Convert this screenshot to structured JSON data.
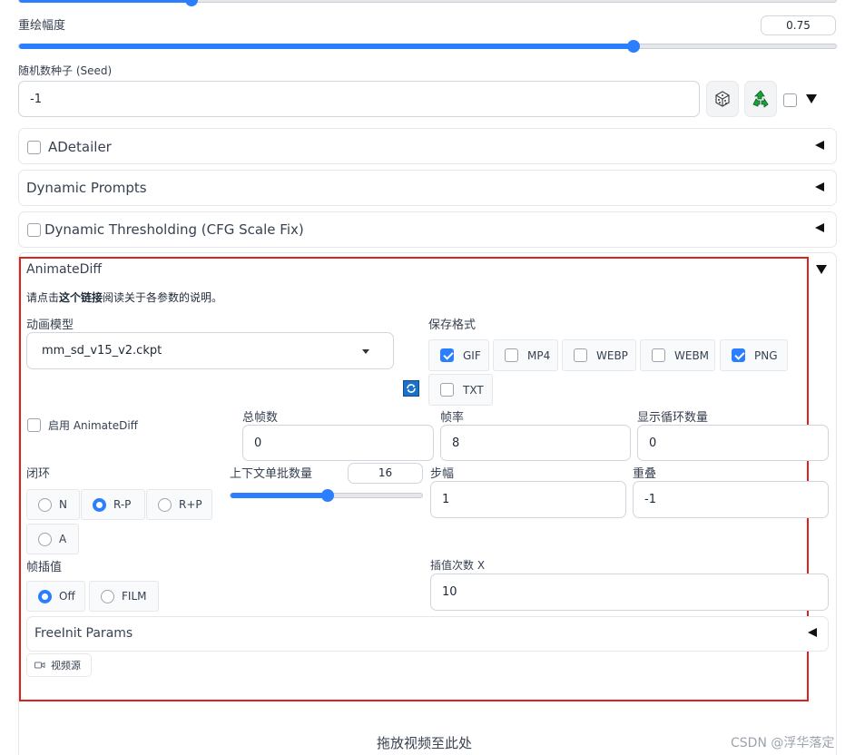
{
  "denoise": {
    "label": "重绘幅度",
    "value": "0.75",
    "fraction": 0.75
  },
  "seed": {
    "label": "随机数种子 (Seed)",
    "value": "-1"
  },
  "sections": {
    "adetailer": "ADetailer",
    "dynamic_prompts": "Dynamic Prompts",
    "dynamic_thresholding": "Dynamic Thresholding (CFG Scale Fix)"
  },
  "animatediff": {
    "title": "AnimateDiff",
    "desc_prefix": "请点击",
    "desc_link": "这个链接",
    "desc_suffix": "阅读关于各参数的说明。",
    "model_label": "动画模型",
    "model_value": "mm_sd_v15_v2.ckpt",
    "format_label": "保存格式",
    "formats": [
      {
        "label": "GIF",
        "checked": true
      },
      {
        "label": "MP4",
        "checked": false
      },
      {
        "label": "WEBP",
        "checked": false
      },
      {
        "label": "WEBM",
        "checked": false
      },
      {
        "label": "PNG",
        "checked": true
      },
      {
        "label": "TXT",
        "checked": false
      }
    ],
    "enable_label": "启用 AnimateDiff",
    "frames_label": "总帧数",
    "frames_value": "0",
    "fps_label": "帧率",
    "fps_value": "8",
    "loop_count_label": "显示循环数量",
    "loop_count_value": "0",
    "closed_loop_label": "闭环",
    "closed_loop_options": [
      "N",
      "R-P",
      "R+P",
      "A"
    ],
    "closed_loop_selected": "R-P",
    "context_label": "上下文单批数量",
    "context_value": "16",
    "context_fraction": 0.5,
    "stride_label": "步幅",
    "stride_value": "1",
    "overlap_label": "重叠",
    "overlap_value": "-1",
    "interp_label": "帧插值",
    "interp_options": [
      "Off",
      "FILM"
    ],
    "interp_selected": "Off",
    "interp_x_label": "插值次数 X",
    "interp_x_value": "10",
    "freeinit_label": "FreeInit Params",
    "video_source_label": "视频源",
    "drop_text": "拖放视频至此处"
  },
  "watermark": "CSDN @浮华落定",
  "colors": {
    "accent": "#2b7fff",
    "highlight": "#e0201b"
  }
}
